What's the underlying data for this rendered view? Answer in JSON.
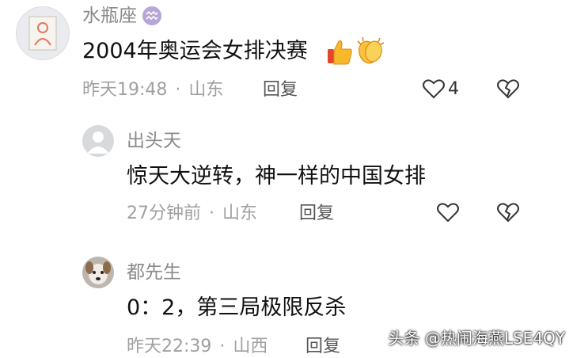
{
  "comments": [
    {
      "name": "水瓶座",
      "text": "2004年奥运会女排决赛",
      "time": "昨天19:48",
      "location": "山东",
      "reply_label": "回复",
      "like_count": "4",
      "avatar_icon": "sketch-avatar-icon",
      "badge_icon": "aquarius-badge-icon",
      "emojis": [
        "thumbs-up-emoji",
        "clapping-hands-emoji"
      ]
    },
    {
      "name": "出头天",
      "text": "惊天大逆转，神一样的中国女排",
      "time": "27分钟前",
      "location": "山东",
      "reply_label": "回复",
      "avatar_icon": "default-user-avatar-icon"
    },
    {
      "name": "都先生",
      "text": "0：2，第三局极限反杀",
      "time": "昨天22:39",
      "location": "山西",
      "reply_label": "回复",
      "avatar_icon": "dog-avatar-icon"
    }
  ],
  "watermark": "头条 @热闹海燕LSE4QY",
  "colors": {
    "meta": "#a0a0a0",
    "name": "#8a8a8a",
    "text": "#111111"
  }
}
